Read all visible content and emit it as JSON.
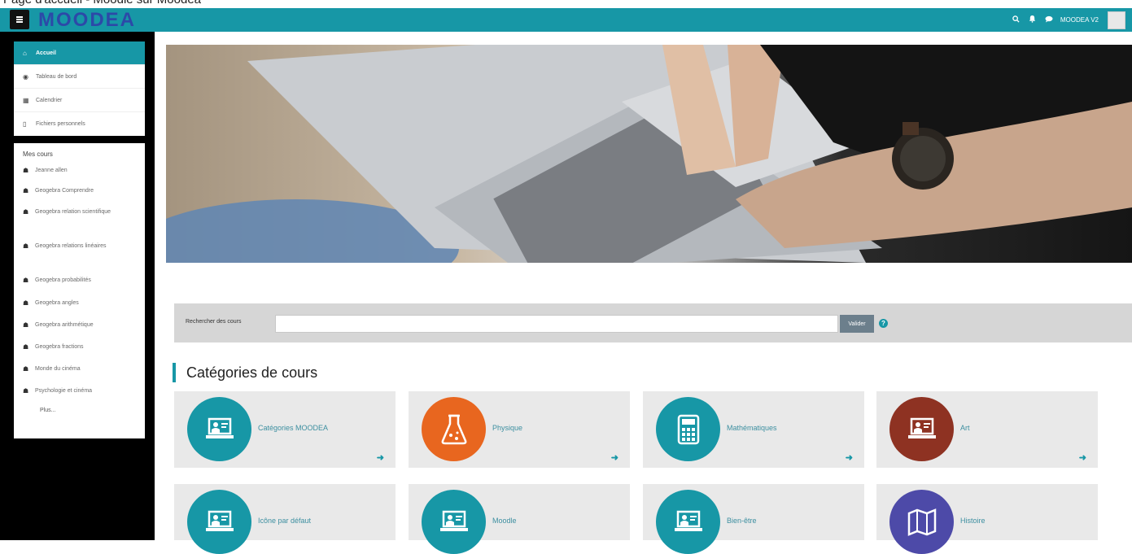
{
  "window_caption": "Page d'accueil - Moodle sur Moodea",
  "navbar": {
    "brand": "MOODEA",
    "user_name": "MOODEA V2",
    "icons": [
      "search-icon",
      "bell-icon",
      "chat-icon"
    ]
  },
  "nav_block": {
    "items": [
      {
        "label": "Accueil",
        "icon": "home-icon",
        "active": true
      },
      {
        "label": "Tableau de bord",
        "icon": "dashboard-icon"
      },
      {
        "label": "Calendrier",
        "icon": "calendar-icon"
      },
      {
        "label": "Fichiers personnels",
        "icon": "file-icon"
      }
    ]
  },
  "courses_block": {
    "title": "Mes cours",
    "items": [
      {
        "label": "Jeanne allen"
      },
      {
        "label": "Geogebra Comprendre"
      },
      {
        "label": "Geogebra relation scientifique"
      },
      {
        "label": "Geogebra relations linéaires"
      },
      {
        "label": "Geogebra probabilités"
      },
      {
        "label": "Geogebra angles"
      },
      {
        "label": "Geogebra arithmétique"
      },
      {
        "label": "Geogebra fractions"
      },
      {
        "label": "Monde du cinéma"
      },
      {
        "label": "Psychologie et cinéma"
      }
    ],
    "more": "Plus..."
  },
  "search": {
    "label": "Rechercher des cours",
    "value": "",
    "button": "Valider"
  },
  "categories": {
    "title": "Catégories de cours",
    "items": [
      {
        "name": "Catégories MOODEA",
        "icon": "classroom-icon",
        "color": "#1797a6"
      },
      {
        "name": "Physique",
        "icon": "flask-icon",
        "color": "#e8661f"
      },
      {
        "name": "Mathématiques",
        "icon": "calculator-icon",
        "color": "#1797a6"
      },
      {
        "name": "Art",
        "icon": "classroom-icon",
        "color": "#8e3222"
      },
      {
        "name": "Icône par défaut",
        "icon": "classroom-icon",
        "color": "#1797a6"
      },
      {
        "name": "Moodle",
        "icon": "classroom-icon",
        "color": "#1797a6"
      },
      {
        "name": "Bien-être",
        "icon": "classroom-icon",
        "color": "#1797a6"
      },
      {
        "name": "Histoire",
        "icon": "map-icon",
        "color": "#4d4aa8"
      }
    ]
  },
  "colors": {
    "accent": "#1797a6",
    "brand": "#2c49a8",
    "sidebar_bg": "#000000"
  }
}
